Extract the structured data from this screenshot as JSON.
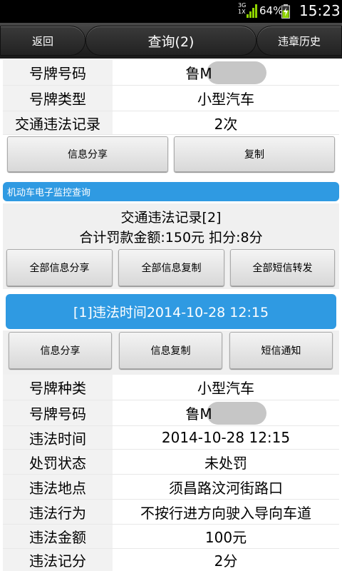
{
  "status_bar": {
    "network": "3G",
    "network2": "1X",
    "battery_percent": "64%",
    "battery_level": 0.64,
    "time": "15:23",
    "signal_icon": "signal-bars-icon",
    "battery_icon": "battery-charging-icon"
  },
  "title_bar": {
    "back_label": "返回",
    "title": "查询(2)",
    "history_label": "违章历史"
  },
  "vehicle": {
    "rows": [
      {
        "key": "号牌号码",
        "value": "鲁M"
      },
      {
        "key": "号牌类型",
        "value": "小型汽车"
      },
      {
        "key": "交通违法记录",
        "value": "2次"
      }
    ],
    "share_label": "信息分享",
    "copy_label": "复制"
  },
  "section": {
    "title": "机动车电子监控查询"
  },
  "summary": {
    "line1": "交通违法记录[2]",
    "line2": "合计罚款金额:150元 扣分:8分",
    "share_all": "全部信息分享",
    "copy_all": "全部信息复制",
    "sms_all": "全部短信转发"
  },
  "violation": {
    "header": "[1]违法时间2014-10-28 12:15",
    "share_label": "信息分享",
    "copy_label": "信息复制",
    "sms_label": "短信通知",
    "rows": [
      {
        "key": "号牌种类",
        "value": "小型汽车"
      },
      {
        "key": "号牌号码",
        "value": "鲁M"
      },
      {
        "key": "违法时间",
        "value": "2014-10-28 12:15"
      },
      {
        "key": "处罚状态",
        "value": "未处罚"
      },
      {
        "key": "违法地点",
        "value": "须昌路汶河街路口"
      },
      {
        "key": "违法行为",
        "value": "不按行进方向驶入导向车道"
      },
      {
        "key": "违法金额",
        "value": "100元"
      },
      {
        "key": "违法记分",
        "value": "2分"
      }
    ]
  },
  "colors": {
    "accent_blue": "#2f9ae2",
    "titlebar_dark": "#2a2a2a"
  }
}
